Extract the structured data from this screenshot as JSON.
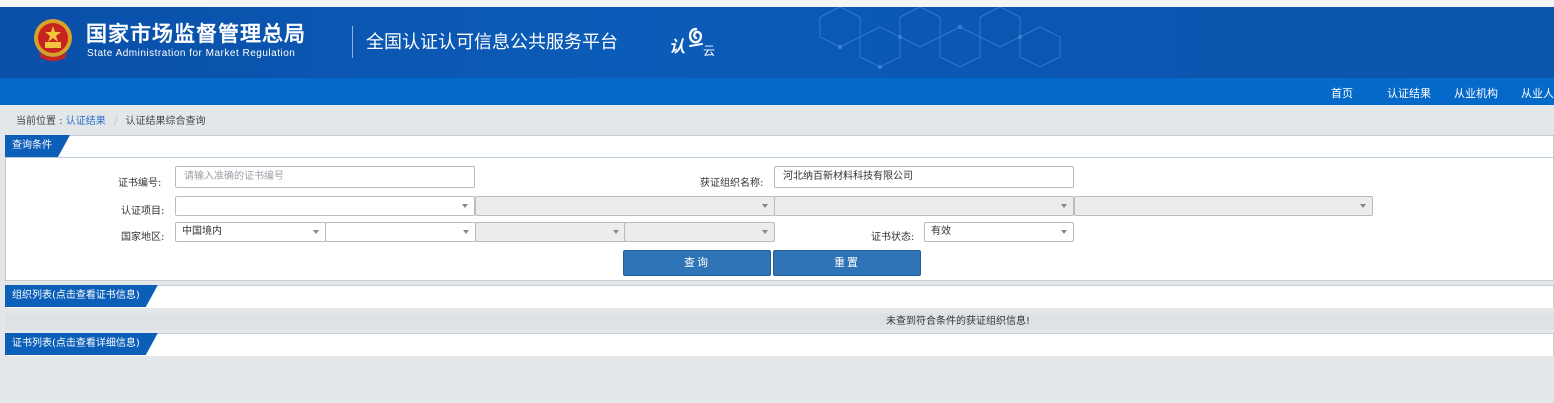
{
  "header": {
    "org_name_cn": "国家市场监督管理总局",
    "org_name_en": "State Administration  for  Market Regulation",
    "platform_title": "全国认证认可信息公共服务平台",
    "logo_text_1": "认",
    "logo_text_2": "云",
    "colors": {
      "header_blue": "#0b5cb8",
      "nav_blue": "#0569c9",
      "tab_blue": "#0c5fb9"
    }
  },
  "nav": {
    "items": [
      "首页",
      "认证结果",
      "从业机构",
      "从业人"
    ]
  },
  "breadcrumb": {
    "prefix": "当前位置 :",
    "link": "认证结果",
    "separator": "/",
    "current": "认证结果综合查询"
  },
  "query_panel": {
    "tab_label": "查询条件",
    "cert_no_label": "证书编号:",
    "cert_no_placeholder": "请输入准确的证书编号",
    "org_name_label": "获证组织名称:",
    "org_name_value": "河北纳百新材料科技有限公司",
    "project_label": "认证项目:",
    "region_label": "国家地区:",
    "region_value": "中国境内",
    "status_label": "证书状态:",
    "status_value": "有效",
    "search_button": "查询",
    "reset_button": "重置"
  },
  "org_list_panel": {
    "tab_label": "组织列表(点击查看证书信息)",
    "empty_message": "未查到符合条件的获证组织信息!"
  },
  "cert_list_panel": {
    "tab_label": "证书列表(点击查看详细信息)"
  }
}
